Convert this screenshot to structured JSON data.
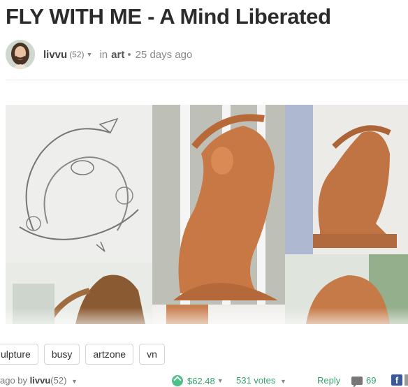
{
  "post": {
    "title": "FLY WITH ME - A Mind Liberated",
    "author": "livvu",
    "reputation": "(52)",
    "in_label": "in",
    "category": "art",
    "separator": "•",
    "time_ago": "25 days ago"
  },
  "tags": [
    "ulpture",
    "busy",
    "artzone",
    "vn"
  ],
  "footer": {
    "ago_prefix": "ago by",
    "author": "livvu",
    "reputation": "(52)",
    "payout": "$62.48",
    "votes": "531 votes",
    "reply_label": "Reply",
    "comment_count": "69"
  },
  "colors": {
    "accent_green": "#38a46b",
    "upvote_green": "#4ebf88",
    "title": "#2b2b2b",
    "facebook_blue": "#3b5998"
  },
  "icons": [
    "caret-down-icon",
    "upvote-icon",
    "comment-icon",
    "facebook-icon",
    "share-icon"
  ]
}
